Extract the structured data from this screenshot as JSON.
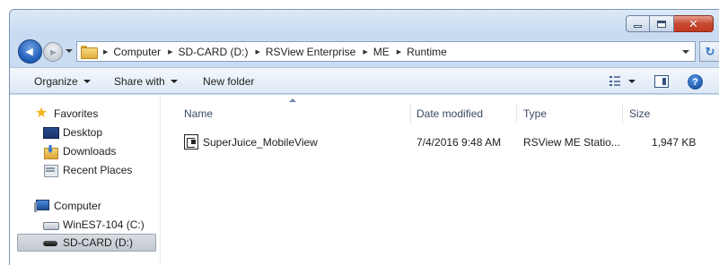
{
  "window": {
    "caption_buttons": {
      "minimize_icon": "minimize-icon",
      "maximize_icon": "maximize-icon",
      "close_icon": "close-icon",
      "close_glyph": "✕"
    }
  },
  "address_bar": {
    "back_glyph": "◀",
    "forward_glyph": "▶",
    "breadcrumbs": [
      "Computer",
      "SD-CARD (D:)",
      "RSView Enterprise",
      "ME",
      "Runtime"
    ],
    "separator_glyph": "▶",
    "refresh_glyph": "↻"
  },
  "command_bar": {
    "organize_label": "Organize",
    "share_label": "Share with",
    "new_folder_label": "New folder",
    "help_glyph": "?"
  },
  "navigation": {
    "favorites_label": "Favorites",
    "favorites": [
      {
        "label": "Desktop",
        "icon": "desktop-icon"
      },
      {
        "label": "Downloads",
        "icon": "downloads-icon"
      },
      {
        "label": "Recent Places",
        "icon": "recent-places-icon"
      }
    ],
    "computer_label": "Computer",
    "drives": [
      {
        "label": "WinES7-104 (C:)",
        "icon": "drive-icon"
      },
      {
        "label": "SD-CARD (D:)",
        "icon": "sd-card-icon",
        "selected": true
      }
    ]
  },
  "file_list": {
    "columns": {
      "name": "Name",
      "date": "Date modified",
      "type": "Type",
      "size": "Size"
    },
    "rows": [
      {
        "name": "SuperJuice_MobileView",
        "date": "7/4/2016 9:48 AM",
        "type": "RSView ME Statio...",
        "size": "1,947 KB",
        "icon": "runtime-file-icon"
      }
    ]
  }
}
